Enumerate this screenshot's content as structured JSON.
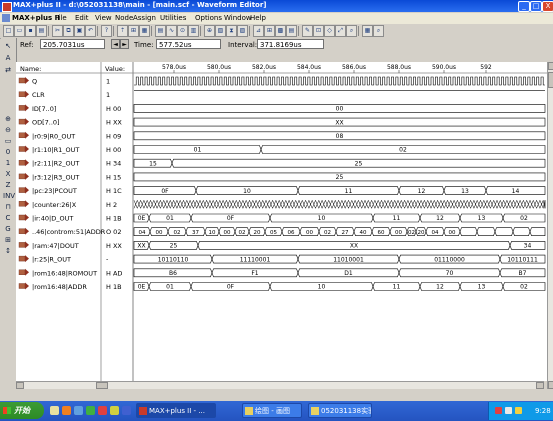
{
  "window": {
    "title": "MAX+plus II - d:\\052031138\\main - [main.scf - Waveform Editor]",
    "controls": [
      "_",
      "□",
      "X"
    ]
  },
  "menu": [
    "MAX+plus II",
    "File",
    "Edit",
    "View",
    "Node",
    "Assign",
    "Utilities",
    "Options",
    "Window",
    "Help"
  ],
  "toolbar_icons": [
    "new-icon",
    "open-icon",
    "save-icon",
    "print-icon",
    "cut-icon",
    "copy-icon",
    "paste-icon",
    "undo-icon",
    "help-icon",
    "hierarchy-up-icon",
    "hierarchy-icon",
    "floorplan-icon",
    "compiler-icon",
    "simulator-icon",
    "timing-icon",
    "programmer-icon",
    "search-icon"
  ],
  "waveform": {
    "ref_label": "Ref:",
    "ref_value": "205.7031us",
    "time_label": "Time:",
    "time_value": "577.52us",
    "interval_label": "Interval:",
    "interval_value": "371.8169us",
    "name_header": "Name:",
    "value_header": "Value:",
    "time_ticks": [
      "578.0us",
      "580.0us",
      "582.0us",
      "584.0us",
      "586.0us",
      "588.0us",
      "590.0us",
      "592"
    ],
    "signals": [
      {
        "name": "Q",
        "value": "1"
      },
      {
        "name": "CLR",
        "value": "1"
      },
      {
        "name": "ID[7..0]",
        "value": "H 00"
      },
      {
        "name": "OD[7..0]",
        "value": "H XX"
      },
      {
        "name": "|r0:9|R0_OUT",
        "value": "H 09"
      },
      {
        "name": "|r1:10|R1_OUT",
        "value": "H 00"
      },
      {
        "name": "|r2:11|R2_OUT",
        "value": "H 34"
      },
      {
        "name": "|r3:12|R3_OUT",
        "value": "H 15"
      },
      {
        "name": "|pc:23|PCOUT",
        "value": "H 1C"
      },
      {
        "name": "|counter:26|X",
        "value": "H 2"
      },
      {
        "name": "|ir:40|D_OUT",
        "value": "H 1B"
      },
      {
        "name": "..46|controm:51|ADDR",
        "value": "O 02"
      },
      {
        "name": "|ram:47|DOUT",
        "value": "H XX"
      },
      {
        "name": "|r:25|R_OUT",
        "value": "-"
      },
      {
        "name": "|rom16:48|ROMOUT",
        "value": "H AD"
      },
      {
        "name": "|rom16:48|ADDR",
        "value": "H 1B"
      }
    ],
    "bus_labels": {
      "id": "00",
      "od": "XX",
      "r0": "08",
      "r1": [
        "01",
        "02"
      ],
      "r2": [
        "15",
        "25"
      ],
      "r3": "25",
      "pc": [
        "0F",
        "10",
        "11",
        "12",
        "13",
        "14"
      ],
      "ir": [
        "0E",
        "01",
        "0F",
        "10",
        "11",
        "12",
        "13",
        "02"
      ],
      "addr": [
        "04",
        "00",
        "02",
        "37",
        "10",
        "00",
        "02",
        "20",
        "05",
        "06",
        "00",
        "02",
        "27",
        "40",
        "60",
        "00",
        "02",
        "20",
        "04",
        "00"
      ],
      "ram": [
        "XX",
        "25",
        "XX",
        "34"
      ],
      "rout": [
        "10110110",
        "11110001",
        "11010001",
        "01110000",
        "10110111"
      ],
      "romout": [
        "B6",
        "F1",
        "D1",
        "70",
        "B7"
      ],
      "romaddr": [
        "0E",
        "01",
        "0F",
        "10",
        "11",
        "12",
        "13",
        "02"
      ]
    }
  },
  "taskbar": {
    "start": "开始",
    "items": [
      "MAX+plus II - ...",
      "绘图 - 画图",
      "052031138实验"
    ],
    "clock": "9:28"
  }
}
